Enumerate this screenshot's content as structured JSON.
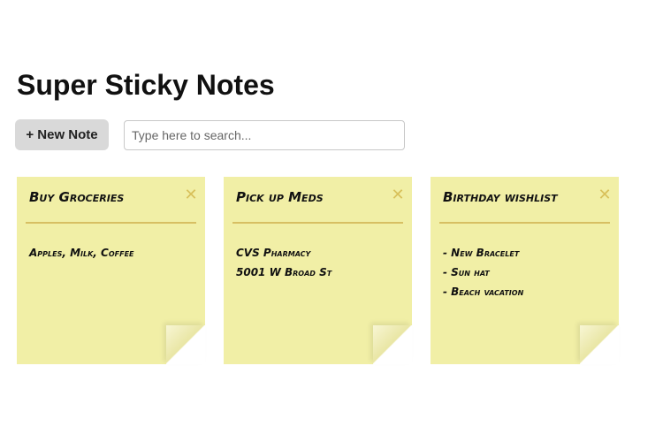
{
  "page": {
    "title": "Super Sticky Notes"
  },
  "toolbar": {
    "new_note_label": "+ New Note",
    "search_placeholder": "Type here to search...",
    "search_value": ""
  },
  "notes": [
    {
      "title": "Buy Groceries",
      "close_label": "✕",
      "lines": [
        "Apples, Milk, Coffee"
      ]
    },
    {
      "title": "Pick up Meds",
      "close_label": "✕",
      "lines": [
        "CVS Pharmacy",
        "5001 W Broad St"
      ]
    },
    {
      "title": "Birthday wishlist",
      "close_label": "✕",
      "lines": [
        "- New Bracelet",
        "- Sun hat",
        "- Beach vacation"
      ]
    }
  ],
  "colors": {
    "note_background": "#f1efa6",
    "note_divider": "#d7bf63",
    "close_icon": "#d8c05a",
    "button_background": "#d9d9d9"
  }
}
